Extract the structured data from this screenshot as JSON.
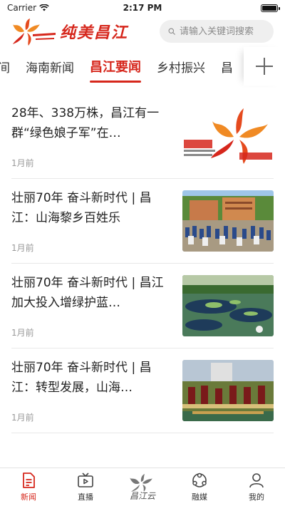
{
  "status_bar": {
    "carrier": "Carrier",
    "time": "2:17 PM"
  },
  "header": {
    "logo_text": "纯美昌江",
    "search_placeholder": "请输入关键词搜索"
  },
  "tabs": [
    {
      "label": "时间",
      "active": false
    },
    {
      "label": "海南新闻",
      "active": false
    },
    {
      "label": "昌江要闻",
      "active": true
    },
    {
      "label": "乡村振兴",
      "active": false
    },
    {
      "label": "昌",
      "active": false
    }
  ],
  "news": [
    {
      "title": "28年、338万株，昌江有一群“绿色娘子军”在…",
      "time": "1月前",
      "thumb": "logo-card"
    },
    {
      "title": "壮丽70年 奋斗新时代 | 昌江：山海黎乡百姓乐",
      "time": "1月前",
      "thumb": "crowd-photo"
    },
    {
      "title": "壮丽70年 奋斗新时代 | 昌江加大投入增绿护蓝…",
      "time": "1月前",
      "thumb": "wetland-photo"
    },
    {
      "title": "壮丽70年 奋斗新时代 | 昌江：转型发展，山海…",
      "time": "1月前",
      "thumb": "dance-photo"
    }
  ],
  "bottom_nav": [
    {
      "label": "新闻",
      "icon": "news-icon",
      "active": true
    },
    {
      "label": "直播",
      "icon": "tv-icon",
      "active": false
    },
    {
      "label": "昌江云",
      "icon": "flower-logo-icon",
      "active": false
    },
    {
      "label": "融媒",
      "icon": "media-icon",
      "active": false
    },
    {
      "label": "我的",
      "icon": "person-icon",
      "active": false
    }
  ],
  "colors": {
    "accent": "#d6271c",
    "logo_orange": "#f08a24"
  }
}
